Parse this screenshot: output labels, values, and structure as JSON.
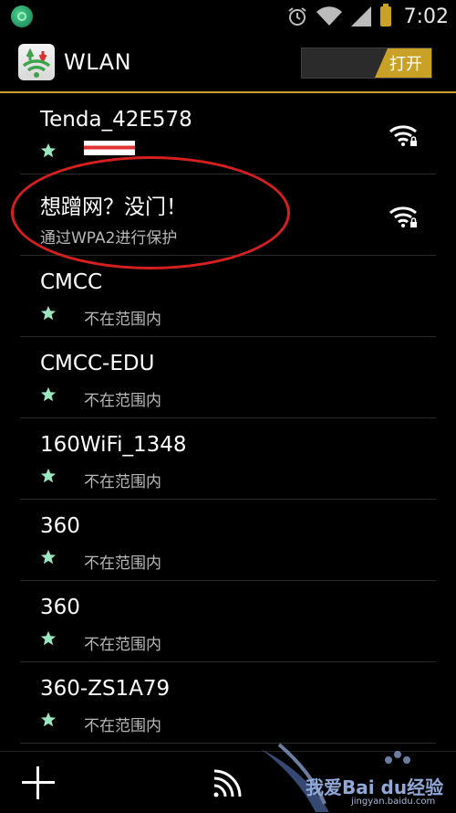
{
  "status_bar": {
    "time": "7:02",
    "icons": [
      "app-notification-icon",
      "alarm-icon",
      "wifi-icon",
      "signal-icon",
      "battery-icon"
    ],
    "battery_color": "#c9a126"
  },
  "header": {
    "title": "WLAN",
    "toggle_label": "打开",
    "accent_color": "#c9a126"
  },
  "networks": [
    {
      "name": "Tenda_42E578",
      "status": "",
      "secured": true,
      "saved": true
    },
    {
      "name": "想蹭网？没门！",
      "status": "通过WPA2进行保护",
      "secured": true,
      "saved": false
    },
    {
      "name": "CMCC",
      "status": "不在范围内",
      "saved": true
    },
    {
      "name": "CMCC-EDU",
      "status": "不在范围内",
      "saved": true
    },
    {
      "name": "160WiFi_1348",
      "status": "不在范围内",
      "saved": true
    },
    {
      "name": "360",
      "status": "不在范围内",
      "saved": true
    },
    {
      "name": "360",
      "status": "不在范围内",
      "saved": true
    },
    {
      "name": "360-ZS1A79",
      "status": "不在范围内",
      "saved": true
    }
  ],
  "annotation_color": "#d62020",
  "watermark": {
    "text": "我爱Bai du经验",
    "sub": "jingyan.baidu.com"
  }
}
